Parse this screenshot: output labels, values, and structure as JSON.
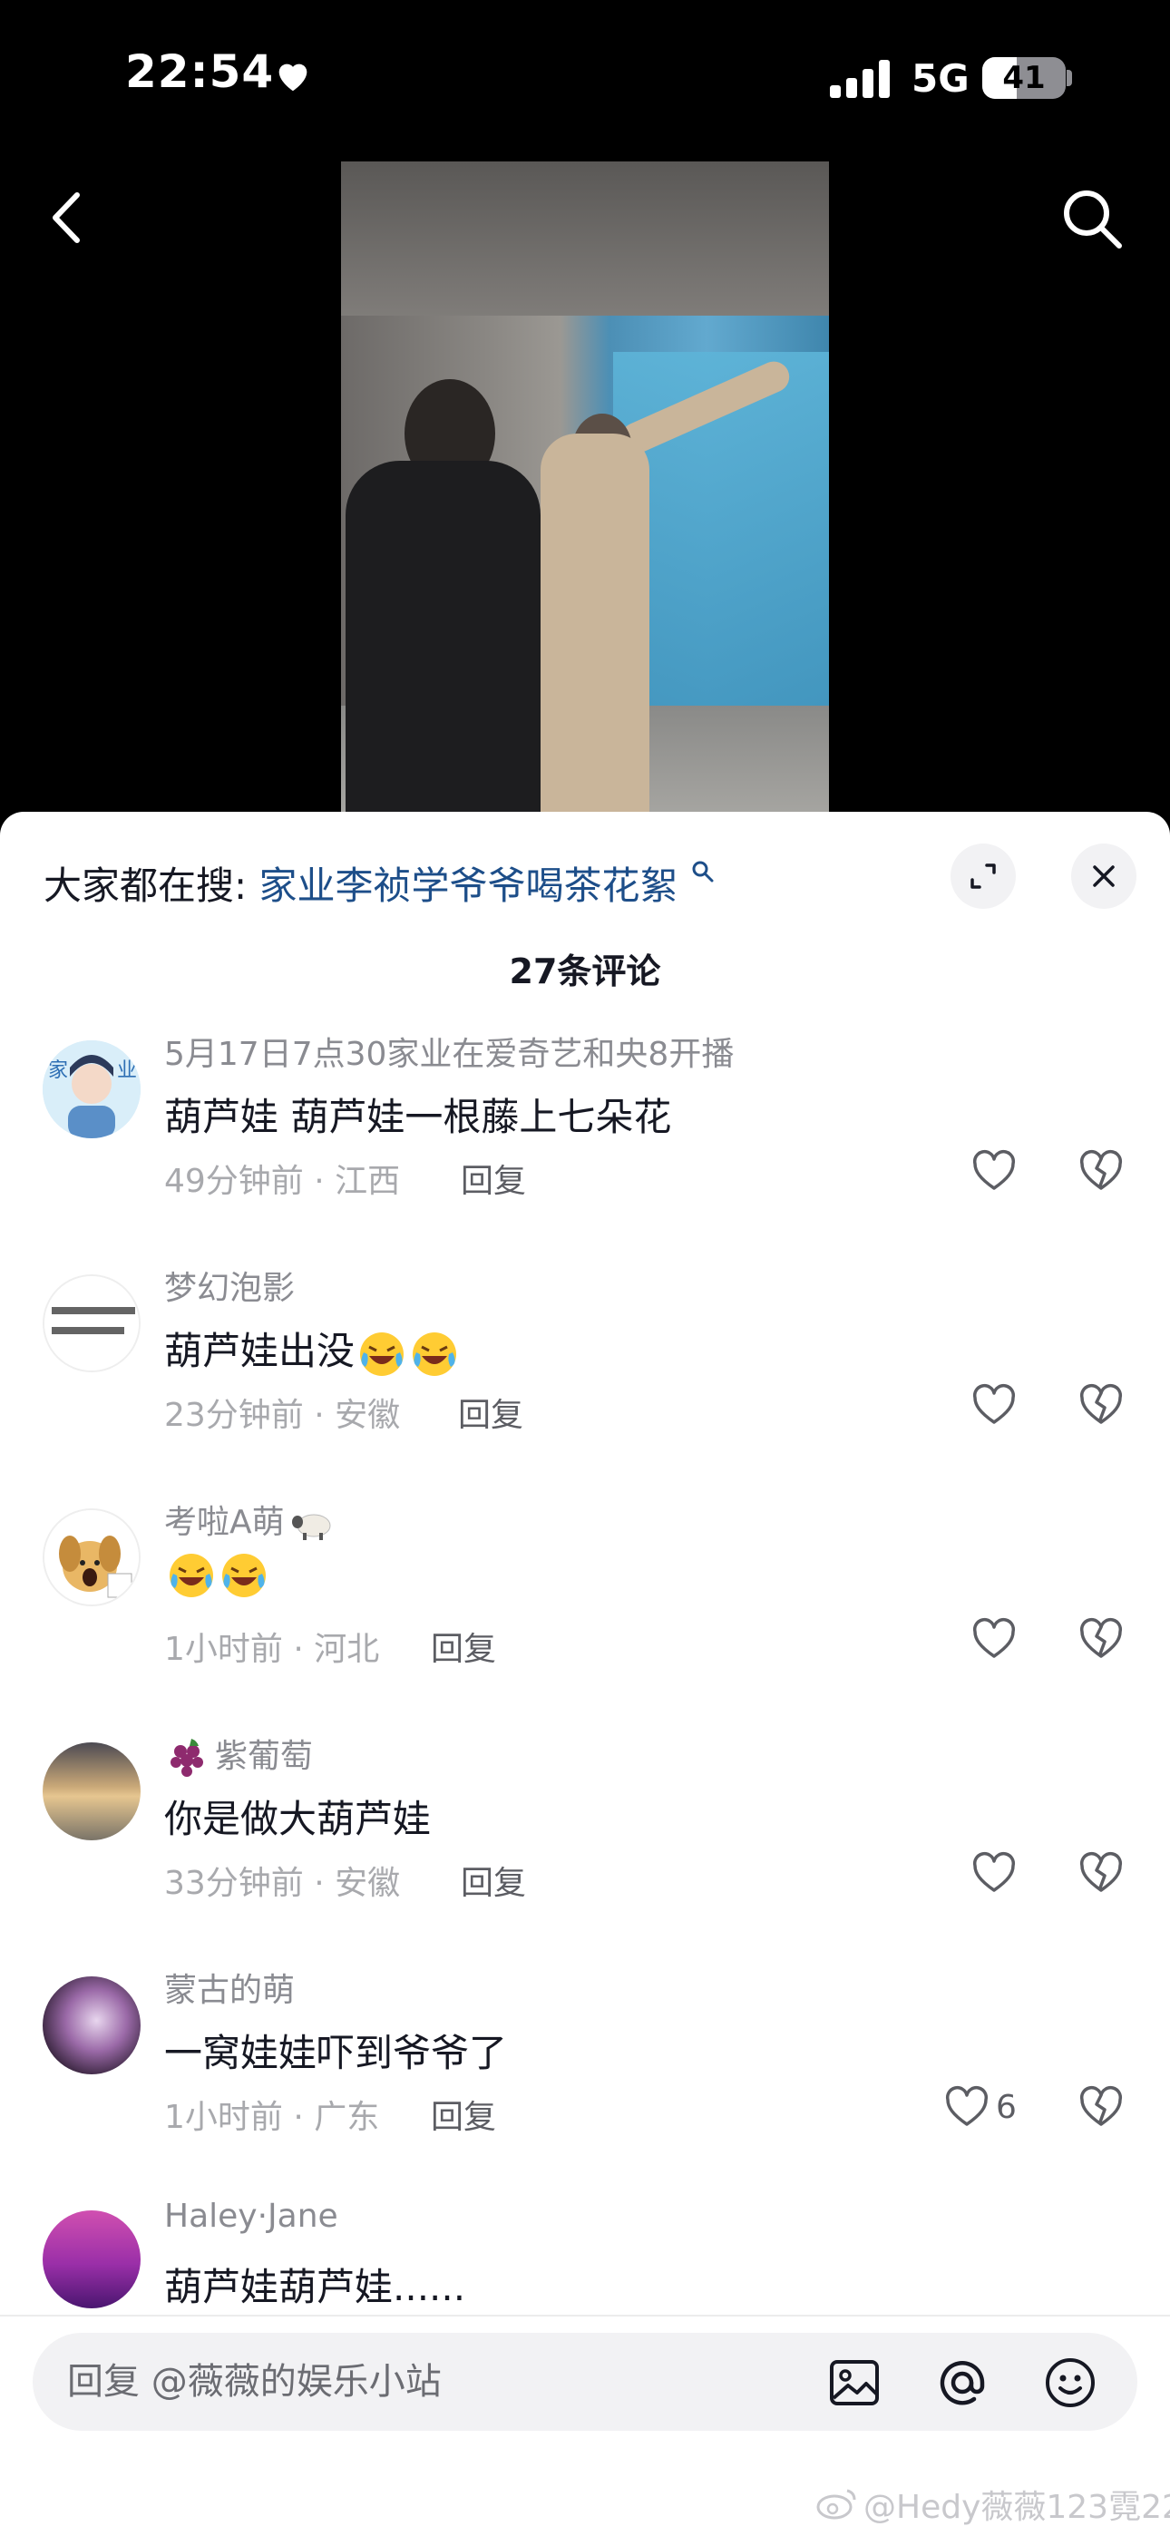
{
  "status_bar": {
    "time": "22:54",
    "network": "5G",
    "battery": "41",
    "battery_level": 0.41
  },
  "nav": {
    "back_icon": "chevron-left-icon",
    "search_icon": "search-icon"
  },
  "sheet": {
    "hot_search_label": "大家都在搜:",
    "hot_search_term": "家业李祯学爷爷喝茶花絮",
    "comment_count": "27条评论"
  },
  "comments": [
    {
      "user": "5月17日7点30家业在爱奇艺和央8开播",
      "text": "葫芦娃 葫芦娃一根藤上七朵花",
      "meta": "49分钟前 · 江西",
      "reply": "回复",
      "likes": ""
    },
    {
      "user": "梦幻泡影",
      "text": "葫芦娃出没",
      "meta": "23分钟前 · 安徽",
      "reply": "回复",
      "likes": ""
    },
    {
      "user": "考啦A萌",
      "text": "",
      "meta": "1小时前 · 河北",
      "reply": "回复",
      "likes": ""
    },
    {
      "user": "紫葡萄",
      "text": "你是做大葫芦娃",
      "meta": "33分钟前 · 安徽",
      "reply": "回复",
      "likes": ""
    },
    {
      "user": "蒙古的萌",
      "text": "一窝娃娃吓到爷爷了",
      "meta": "1小时前 · 广东",
      "reply": "回复",
      "likes": "6"
    },
    {
      "user": "Haley·Jane",
      "text": "葫芦娃葫芦娃......",
      "meta": "",
      "reply": "",
      "likes": ""
    }
  ],
  "reply_bar": {
    "placeholder": "回复 @薇薇的娱乐小站"
  },
  "watermark": "@Hedy薇薇123霓22",
  "colors": {
    "link": "#1d4e89",
    "text": "#161823",
    "secondary": "#8a8b91",
    "sheet_bg": "#ffffff"
  }
}
